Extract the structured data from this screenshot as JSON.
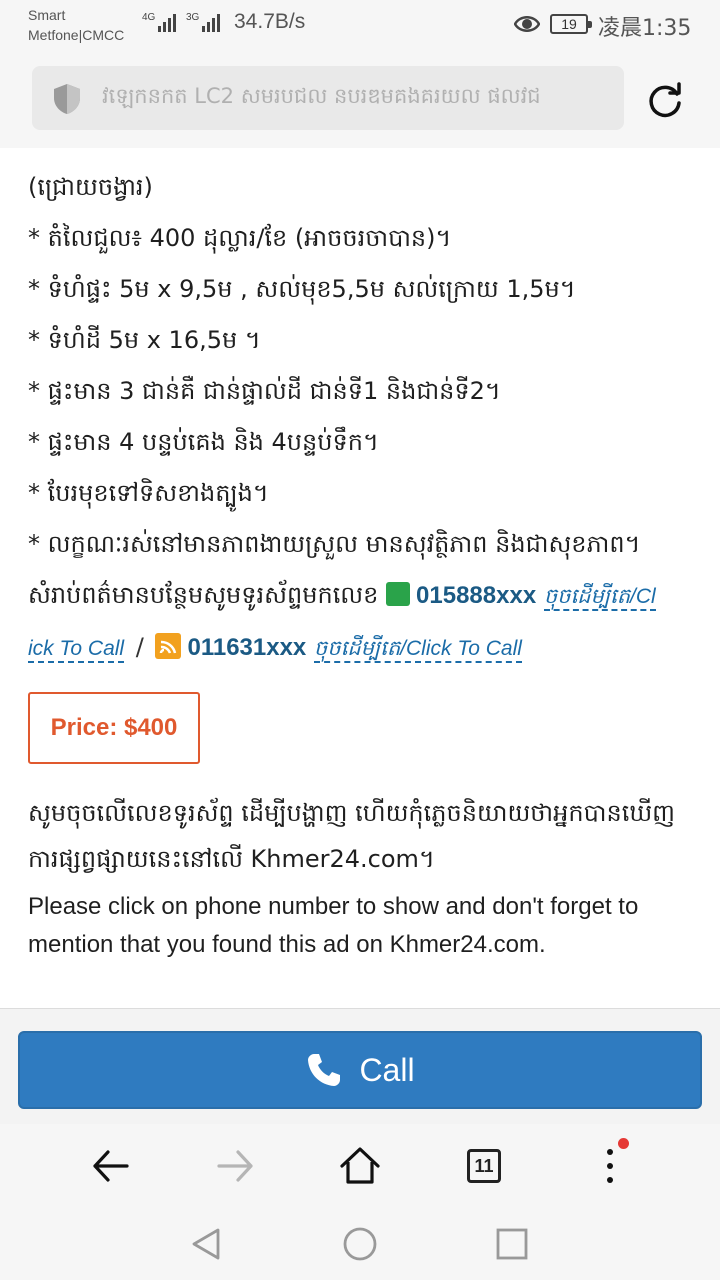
{
  "status": {
    "carrier_line1": "Smart",
    "carrier_line2": "Metfone|CMCC",
    "sig1": "4G",
    "sig2": "3G",
    "speed": "34.7B/s",
    "battery": "19",
    "time": "凌晨1:35"
  },
  "browser": {
    "url_text": "វឡេកនកត LC2 សមរបជល នបរឌមគងគរយល ផលវជ"
  },
  "listing": {
    "lines": [
      "(ជ្រោយចង្វារ)",
      "* តំលៃជួល៖ 400 ដុល្លារ/ខែ (អាចចរចាបាន)។",
      "* ទំហំផ្ទះ 5ម x 9,5ម , សល់មុខ5,5ម សល់ក្រោយ 1,5ម។",
      "* ទំហំដី 5ម x 16,5ម ។",
      "* ផ្ទះមាន 3 ជាន់គឺ ជាន់ផ្ទាល់ដី ជាន់ទី1 និងជាន់ទី2។",
      "* ផ្ទះមាន 4 បន្ទប់គេង និង 4បន្ទប់ទឹក។",
      "* បែរមុខទៅទិសខាងត្បូង។",
      "* លក្ខណៈរស់នៅមានភាពងាយស្រួល មានសុវត្ថិភាព និងជាសុខភាព។"
    ],
    "contact_intro": "សំរាប់ពត៌មានបន្ថែមសូមទូរស័ព្ទមកលេខ",
    "phone1": "015888xxx",
    "call_link1_part1": "ចុចដើម្បីតេ/Cl",
    "call_link1_part2": "ick To Call",
    "separator": "/",
    "phone2": "011631xxx",
    "call_link2": "ចុចដើម្បីតេ/Click To Call",
    "price": "Price: $400",
    "notice_kh": "សូមចុចលើលេខទូរស័ព្ទ ដើម្បីបង្ហាញ ហើយកុំភ្លេចនិយាយថាអ្នកបានឃើញការផ្សព្វផ្សាយនេះនៅលើ Khmer24.com។",
    "notice_en": "Please click on phone number to show and don't forget to mention that you found this ad on Khmer24.com."
  },
  "call_button_label": "Call",
  "toolbar": {
    "tab_count": "11"
  },
  "colors": {
    "accent_blue": "#2f7bc0",
    "price_orange": "#e0592e",
    "phone_blue": "#1b5a84"
  },
  "icons": {
    "status": [
      "eye-icon",
      "battery-icon"
    ],
    "address": [
      "shield-icon",
      "reload-icon"
    ],
    "toolbar": [
      "back-arrow-icon",
      "forward-arrow-icon",
      "home-icon",
      "tabs-icon",
      "more-vert-icon"
    ],
    "nav": [
      "nav-back-icon",
      "nav-home-icon",
      "nav-recents-icon"
    ]
  }
}
